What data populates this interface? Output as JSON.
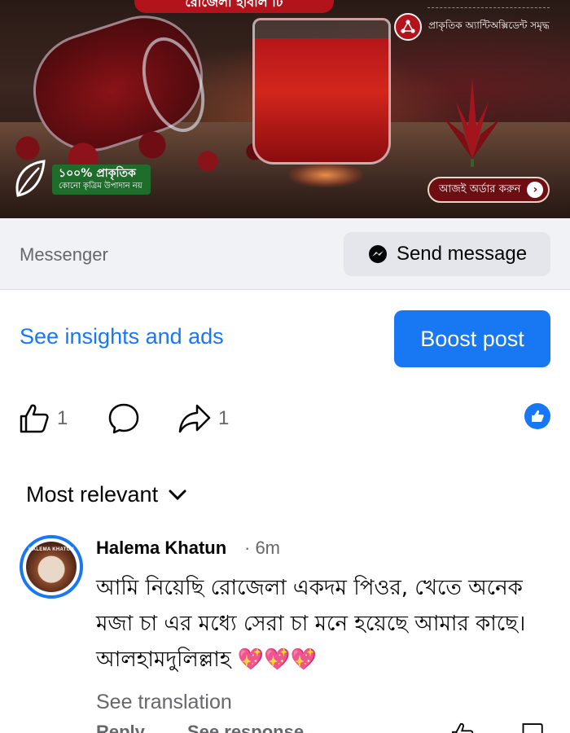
{
  "banner": {
    "top_pill_text": "রোজেলা হার্বাল টি",
    "feature_text": "প্রাকৃতিক অ্যান্টিঅক্সিডেন্ট সমৃদ্ধ",
    "natural_badge_main": "১০০% প্রাকৃতিক",
    "natural_badge_sub": "কোনো কৃত্রিম উপাদান নয়",
    "order_button_label": "আজই অর্ডার করুন",
    "accent_color": "#b3141b"
  },
  "messenger": {
    "label": "Messenger",
    "send_button_label": "Send message"
  },
  "promo": {
    "insights_link": "See insights and ads",
    "boost_button_label": "Boost post"
  },
  "actions": {
    "like_count": "1",
    "share_count": "1"
  },
  "comments_filter": {
    "label": "Most relevant"
  },
  "comment": {
    "author": "Halema Khatun",
    "time": "· 6m",
    "avatar_text": "HALEMA KHATUN",
    "body": "আমি নিয়েছি রোজেলা একদম পিওর, খেতে অনেক মজা চা এর মধ্যে সেরা চা মনে হয়েছে আমার কাছে। আলহামদুলিল্লাহ 💖💖💖",
    "see_translation": "See translation",
    "reply_label": "Reply",
    "see_response_label": "See response"
  }
}
